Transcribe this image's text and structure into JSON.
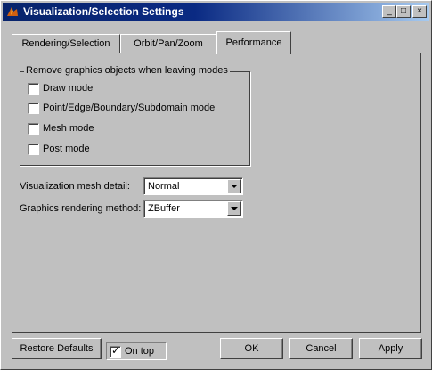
{
  "window": {
    "title": "Visualization/Selection Settings",
    "controls": {
      "minimize": "_",
      "maximize": "□",
      "close": "×"
    }
  },
  "tabs": [
    {
      "label": "Rendering/Selection",
      "active": false
    },
    {
      "label": "Orbit/Pan/Zoom",
      "active": false
    },
    {
      "label": "Performance",
      "active": true
    }
  ],
  "remove_group": {
    "title": "Remove graphics objects when leaving modes",
    "options": [
      {
        "label": "Draw mode",
        "checked": false
      },
      {
        "label": "Point/Edge/Boundary/Subdomain mode",
        "checked": false
      },
      {
        "label": "Mesh mode",
        "checked": false
      },
      {
        "label": "Post mode",
        "checked": false
      }
    ]
  },
  "fields": {
    "mesh_detail": {
      "label": "Visualization mesh detail:",
      "value": "Normal"
    },
    "rendering_method": {
      "label": "Graphics rendering method:",
      "value": "ZBuffer"
    }
  },
  "footer": {
    "restore_defaults": "Restore Defaults",
    "on_top": {
      "label": "On top",
      "checked": true
    },
    "ok": "OK",
    "cancel": "Cancel",
    "apply": "Apply"
  }
}
